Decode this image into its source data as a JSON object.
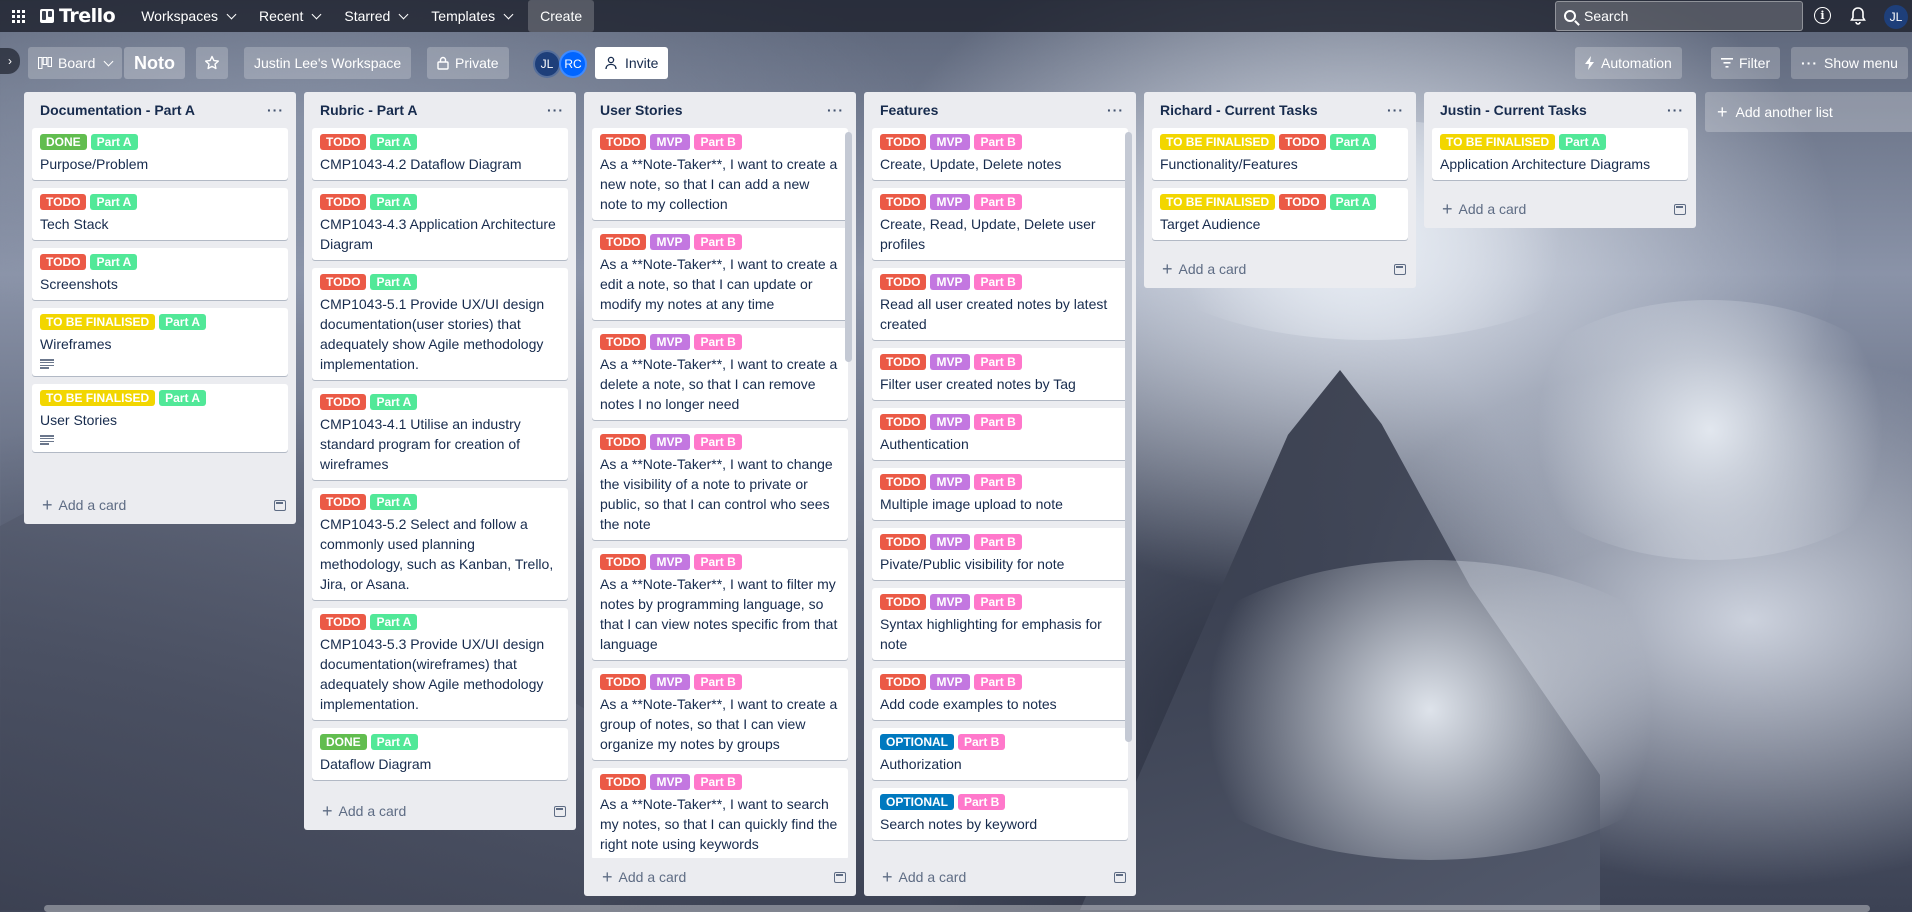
{
  "colors": {
    "TODO": "#eb5a46",
    "DONE": "#61bd4f",
    "Part A": "#51e898",
    "Part B": "#ff78cb",
    "MVP": "#c377e0",
    "TO BE FINALISED": "#f2d600",
    "OPTIONAL": "#0079bf"
  },
  "topnav": {
    "logo": "Trello",
    "workspaces": "Workspaces",
    "recent": "Recent",
    "starred": "Starred",
    "templates": "Templates",
    "create": "Create",
    "search_placeholder": "Search",
    "user_initials": "JL"
  },
  "board": {
    "view": "Board",
    "name": "Noto",
    "workspace": "Justin Lee's Workspace",
    "visibility": "Private",
    "members": [
      "JL",
      "RC"
    ],
    "invite": "Invite",
    "automation": "Automation",
    "filter": "Filter",
    "show_menu": "Show menu",
    "add_list": "Add another list"
  },
  "lists": [
    {
      "title": "Documentation - Part A",
      "footer": "Add a card",
      "cards": [
        {
          "labels": [
            "DONE",
            "Part A"
          ],
          "title": "Purpose/Problem"
        },
        {
          "labels": [
            "TODO",
            "Part A"
          ],
          "title": "Tech Stack"
        },
        {
          "labels": [
            "TODO",
            "Part A"
          ],
          "title": "Screenshots"
        },
        {
          "labels": [
            "TO BE FINALISED",
            "Part A"
          ],
          "title": "Wireframes",
          "desc": true
        },
        {
          "labels": [
            "TO BE FINALISED",
            "Part A"
          ],
          "title": "User Stories",
          "desc": true
        }
      ]
    },
    {
      "title": "Rubric - Part A",
      "footer": "Add a card",
      "cards": [
        {
          "labels": [
            "TODO",
            "Part A"
          ],
          "title": "CMP1043-4.2 Dataflow Diagram"
        },
        {
          "labels": [
            "TODO",
            "Part A"
          ],
          "title": "CMP1043-4.3 Application Architecture Diagram"
        },
        {
          "labels": [
            "TODO",
            "Part A"
          ],
          "title": "CMP1043-5.1 Provide UX/UI design documentation(user stories) that adequately show Agile methodology implementation."
        },
        {
          "labels": [
            "TODO",
            "Part A"
          ],
          "title": "CMP1043-4.1 Utilise an industry standard program for creation of wireframes"
        },
        {
          "labels": [
            "TODO",
            "Part A"
          ],
          "title": "CMP1043-5.2 Select and follow a commonly used planning methodology, such as Kanban, Trello, Jira, or Asana."
        },
        {
          "labels": [
            "TODO",
            "Part A"
          ],
          "title": "CMP1043-5.3 Provide UX/UI design documentation(wireframes) that adequately show Agile methodology implementation."
        },
        {
          "labels": [
            "DONE",
            "Part A"
          ],
          "title": "Dataflow Diagram"
        }
      ]
    },
    {
      "title": "User Stories",
      "footer": "Add a card",
      "cards": [
        {
          "labels": [
            "TODO",
            "MVP",
            "Part B"
          ],
          "title": "As a **Note-Taker**, I want to create a new note, so that I can add a new note to my collection"
        },
        {
          "labels": [
            "TODO",
            "MVP",
            "Part B"
          ],
          "title": "As a **Note-Taker**, I want to create a edit a note, so that I can update or modify my notes at any time"
        },
        {
          "labels": [
            "TODO",
            "MVP",
            "Part B"
          ],
          "title": "As a **Note-Taker**, I want to create a delete a note, so that I can remove notes I no longer need"
        },
        {
          "labels": [
            "TODO",
            "MVP",
            "Part B"
          ],
          "title": "As a **Note-Taker**, I want to change the visibility of a note to private or public, so that I can control who sees the note"
        },
        {
          "labels": [
            "TODO",
            "MVP",
            "Part B"
          ],
          "title": "As a **Note-Taker**, I want to filter my notes by programming language, so that I can view notes specific from that language"
        },
        {
          "labels": [
            "TODO",
            "MVP",
            "Part B"
          ],
          "title": "As a **Note-Taker**, I want to create a group of notes, so that I can view organize my notes by groups"
        },
        {
          "labels": [
            "TODO",
            "MVP",
            "Part B"
          ],
          "title": "As a **Note-Taker**, I want to search my notes, so that I can quickly find the right note using keywords"
        }
      ]
    },
    {
      "title": "Features",
      "footer": "Add a card",
      "cards": [
        {
          "labels": [
            "TODO",
            "MVP",
            "Part B"
          ],
          "title": "Create, Update, Delete notes"
        },
        {
          "labels": [
            "TODO",
            "MVP",
            "Part B"
          ],
          "title": "Create, Read, Update, Delete user profiles"
        },
        {
          "labels": [
            "TODO",
            "MVP",
            "Part B"
          ],
          "title": "Read all user created notes by latest created"
        },
        {
          "labels": [
            "TODO",
            "MVP",
            "Part B"
          ],
          "title": "Filter user created notes by Tag"
        },
        {
          "labels": [
            "TODO",
            "MVP",
            "Part B"
          ],
          "title": "Authentication"
        },
        {
          "labels": [
            "TODO",
            "MVP",
            "Part B"
          ],
          "title": "Multiple image upload to note"
        },
        {
          "labels": [
            "TODO",
            "MVP",
            "Part B"
          ],
          "title": "Pivate/Public visibility for note"
        },
        {
          "labels": [
            "TODO",
            "MVP",
            "Part B"
          ],
          "title": "Syntax highlighting for emphasis for note"
        },
        {
          "labels": [
            "TODO",
            "MVP",
            "Part B"
          ],
          "title": "Add code examples to notes"
        },
        {
          "labels": [
            "OPTIONAL",
            "Part B"
          ],
          "title": "Authorization"
        },
        {
          "labels": [
            "OPTIONAL",
            "Part B"
          ],
          "title": "Search notes by keyword"
        }
      ]
    },
    {
      "title": "Richard - Current Tasks",
      "footer": "Add a card",
      "cards": [
        {
          "labels": [
            "TO BE FINALISED",
            "TODO",
            "Part A"
          ],
          "title": "Functionality/Features"
        },
        {
          "labels": [
            "TO BE FINALISED",
            "TODO",
            "Part A"
          ],
          "title": "Target Audience"
        }
      ]
    },
    {
      "title": "Justin - Current Tasks",
      "footer": "Add a card",
      "cards": [
        {
          "labels": [
            "TO BE FINALISED",
            "Part A"
          ],
          "title": "Application Architecture Diagrams"
        }
      ]
    }
  ]
}
